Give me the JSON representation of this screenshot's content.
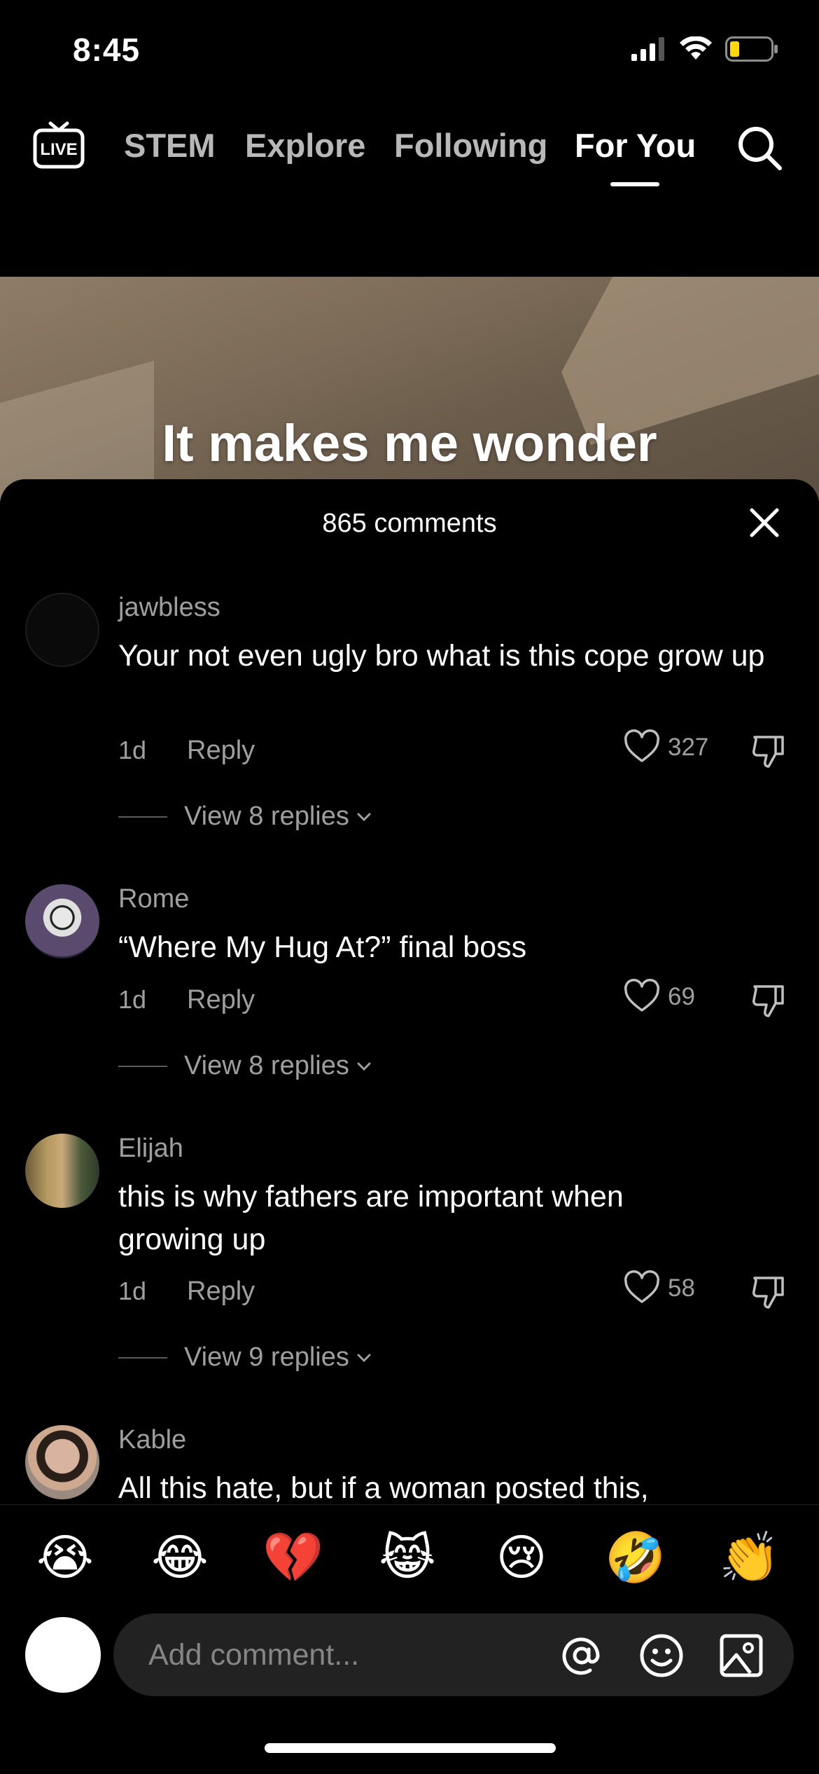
{
  "status_bar": {
    "time": "8:45",
    "icons": [
      "cellular-signal-icon",
      "wifi-icon",
      "battery-low-icon"
    ],
    "battery_color": "#ffd60a"
  },
  "top_nav": {
    "live_label": "LIVE",
    "tabs": [
      {
        "label": "STEM",
        "active": false
      },
      {
        "label": "Explore",
        "active": false
      },
      {
        "label": "Following",
        "active": false
      },
      {
        "label": "For You",
        "active": true
      }
    ],
    "search_icon": "search-icon"
  },
  "video": {
    "caption": "It makes me wonder"
  },
  "comments_sheet": {
    "count_label": "865 comments",
    "close_icon": "close-icon",
    "comments": [
      {
        "username": "jawbless",
        "text": "Your not even ugly bro what is this cope grow up",
        "age": "1d",
        "reply_label": "Reply",
        "likes": "327",
        "view_replies": "View 8 replies"
      },
      {
        "username": "Rome",
        "text": "“Where My Hug At?” final boss",
        "age": "1d",
        "reply_label": "Reply",
        "likes": "69",
        "view_replies": "View 8 replies"
      },
      {
        "username": "Elijah",
        "text": "this is why fathers are important when growing up",
        "age": "1d",
        "reply_label": "Reply",
        "likes": "58",
        "view_replies": "View 9 replies"
      },
      {
        "username": "Kable",
        "text": "All this hate, but if a woman posted this,"
      }
    ]
  },
  "emoji_bar": [
    "😭",
    "😂",
    "💔",
    "😹",
    "😢",
    "🤣",
    "👏"
  ],
  "composer": {
    "placeholder": "Add comment...",
    "icons": [
      "mention-icon",
      "emoji-icon",
      "image-icon"
    ]
  }
}
